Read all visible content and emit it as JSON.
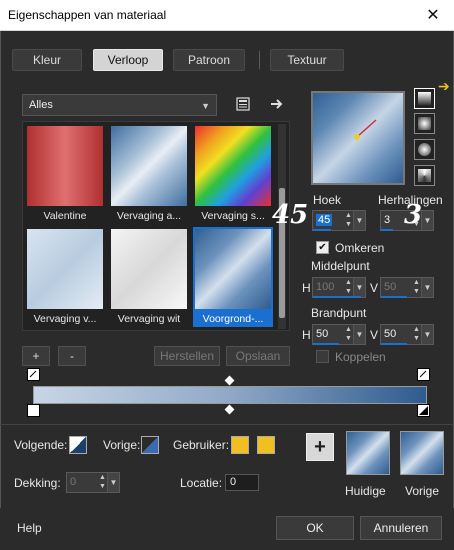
{
  "window": {
    "title": "Eigenschappen van materiaal",
    "close": "✕"
  },
  "tabs": [
    "Kleur",
    "Verloop",
    "Patroon",
    "Textuur"
  ],
  "gallery": {
    "category": "Alles",
    "items": [
      "Valentine",
      "Vervaging a...",
      "Vervaging s...",
      "Vervaging v...",
      "Vervaging wit",
      "Voorgrond-..."
    ],
    "selected_index": 5
  },
  "angle": {
    "label": "Hoek",
    "value": "45",
    "annotation": "45"
  },
  "repeats": {
    "label": "Herhalingen",
    "value": "3",
    "annotation": "3"
  },
  "invert": {
    "label": "Omkeren",
    "checked": true
  },
  "center": {
    "label": "Middelpunt",
    "h_label": "H",
    "h_value": "100",
    "v_label": "V",
    "v_value": "50"
  },
  "focal": {
    "label": "Brandpunt",
    "h_label": "H",
    "h_value": "50",
    "v_label": "V",
    "v_value": "50"
  },
  "link": {
    "label": "Koppelen",
    "checked": false
  },
  "editor_buttons": {
    "add": "+",
    "remove": "-",
    "reset": "Herstellen",
    "save": "Opslaan"
  },
  "colors": {
    "next_label": "Volgende:",
    "prev_label": "Vorige:",
    "user_label": "Gebruiker:",
    "opacity_label": "Dekking:",
    "opacity_value": "0",
    "location_label": "Locatie:",
    "location_value": "0",
    "user_color_1": "#f0c020",
    "user_color_2": "#f0c020"
  },
  "swatches": {
    "current_label": "Huidige",
    "previous_label": "Vorige"
  },
  "footer": {
    "help": "Help",
    "ok": "OK",
    "cancel": "Annuleren"
  }
}
